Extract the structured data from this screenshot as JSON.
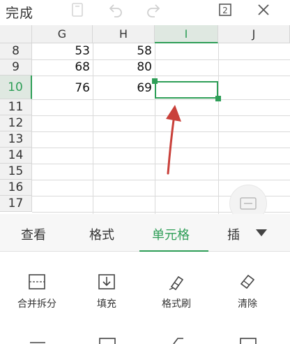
{
  "toolbar": {
    "done_label": "完成"
  },
  "sheet": {
    "columns": [
      "G",
      "H",
      "I",
      "J"
    ],
    "active_column": "I",
    "rows": [
      "8",
      "9",
      "10",
      "11",
      "12",
      "13",
      "14",
      "15",
      "16",
      "17"
    ],
    "active_row": "10",
    "cells": {
      "G8": "53",
      "H8": "58",
      "G9": "68",
      "H9": "80",
      "G10": "76",
      "H10": "69"
    },
    "selected_cell": "I10"
  },
  "tabs": [
    {
      "label": "查看",
      "active": false
    },
    {
      "label": "格式",
      "active": false
    },
    {
      "label": "单元格",
      "active": true
    },
    {
      "label": "插",
      "active": false
    }
  ],
  "tools": [
    {
      "label": "合并拆分",
      "icon": "merge-split-icon"
    },
    {
      "label": "填充",
      "icon": "fill-icon"
    },
    {
      "label": "格式刷",
      "icon": "format-painter-icon"
    },
    {
      "label": "清除",
      "icon": "eraser-icon"
    }
  ],
  "colors": {
    "accent": "#2e9e57",
    "annotation": "#c9403a"
  }
}
